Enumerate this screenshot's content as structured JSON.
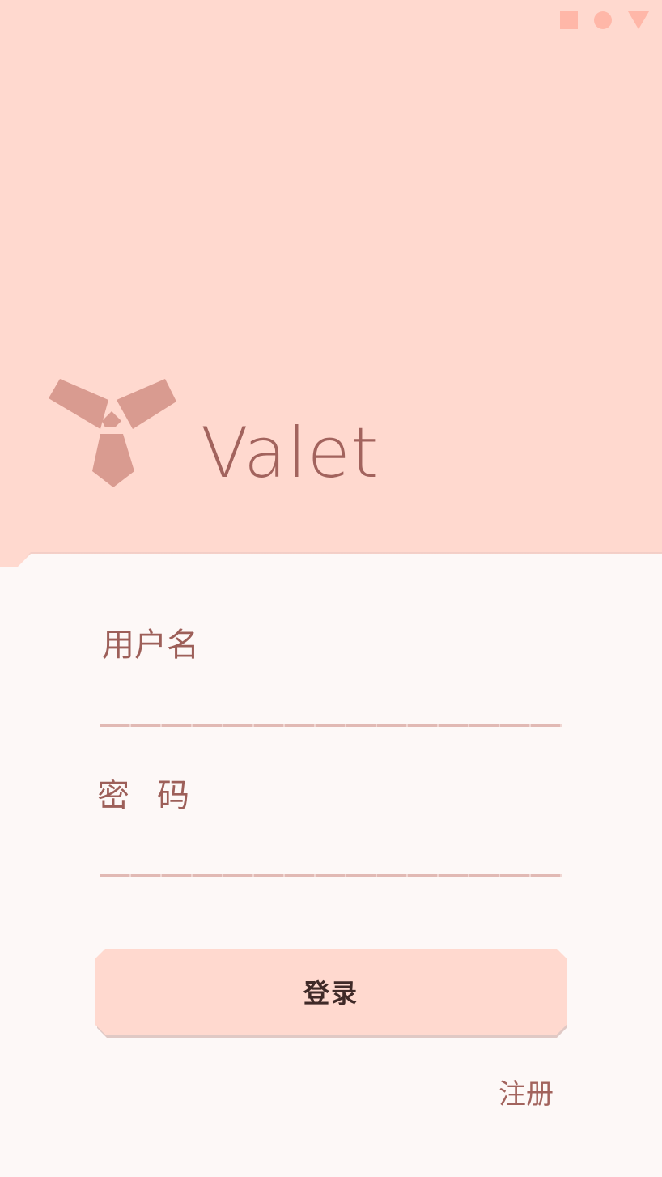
{
  "app": {
    "name": "Valet"
  },
  "status_bar": {
    "icons": [
      "square-icon",
      "circle-icon",
      "triangle-icon"
    ]
  },
  "form": {
    "username_label": "用户名",
    "username_value": "",
    "password_label": "密码",
    "password_value": "",
    "login_label": "登录",
    "register_label": "注册"
  },
  "colors": {
    "header_bg": "#FFD9CF",
    "sheet_bg": "#FDF8F7",
    "brand_text": "#A2635D",
    "logo": "#D99B90",
    "button_text": "#3F2A28"
  }
}
